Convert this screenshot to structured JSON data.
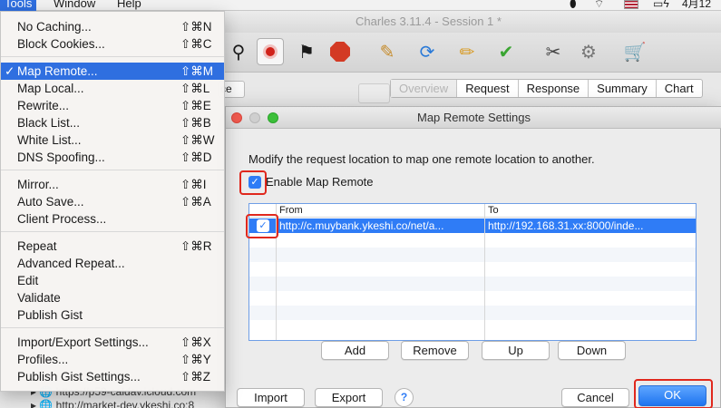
{
  "menubar": {
    "tools": "Tools",
    "window": "Window",
    "help": "Help",
    "flag_icon": "us-flag-icon",
    "clock": "4月12"
  },
  "charles": {
    "title": "Charles 3.11.4 - Session 1 *",
    "sequence_label": "ce",
    "tabs": [
      "Overview",
      "Request",
      "Response",
      "Summary",
      "Chart"
    ],
    "tree_rows": [
      "https://p59-caldav.icloud.com",
      "http://market-dev.ykeshi.co:8"
    ]
  },
  "dialog": {
    "title": "Map Remote Settings",
    "description": "Modify the request location to map one remote location to another.",
    "enable_label": "Enable Map Remote",
    "enable_checked": true,
    "columns": [
      "From",
      "To"
    ],
    "rows": [
      {
        "checked": true,
        "from": "http://c.muybank.ykeshi.co/net/a...",
        "to": "http://192.168.31.xx:8000/inde..."
      }
    ],
    "buttons": {
      "add": "Add",
      "remove": "Remove",
      "up": "Up",
      "down": "Down",
      "import": "Import",
      "export": "Export",
      "help": "?",
      "cancel": "Cancel",
      "ok": "OK"
    },
    "accent": "#2f7cf6",
    "highlight": "#e0281d"
  },
  "menu": {
    "groups": [
      [
        {
          "label": "No Caching...",
          "shortcut": "⇧⌘N"
        },
        {
          "label": "Block Cookies...",
          "shortcut": "⇧⌘C"
        }
      ],
      [
        {
          "label": "Map Remote...",
          "shortcut": "⇧⌘M",
          "checked": true,
          "selected": true
        },
        {
          "label": "Map Local...",
          "shortcut": "⇧⌘L"
        },
        {
          "label": "Rewrite...",
          "shortcut": "⇧⌘E"
        },
        {
          "label": "Black List...",
          "shortcut": "⇧⌘B"
        },
        {
          "label": "White List...",
          "shortcut": "⇧⌘W"
        },
        {
          "label": "DNS Spoofing...",
          "shortcut": "⇧⌘D"
        }
      ],
      [
        {
          "label": "Mirror...",
          "shortcut": "⇧⌘I"
        },
        {
          "label": "Auto Save...",
          "shortcut": "⇧⌘A"
        },
        {
          "label": "Client Process...",
          "shortcut": ""
        }
      ],
      [
        {
          "label": "Repeat",
          "shortcut": "⇧⌘R"
        },
        {
          "label": "Advanced Repeat...",
          "shortcut": ""
        },
        {
          "label": "Edit",
          "shortcut": ""
        },
        {
          "label": "Validate",
          "shortcut": ""
        },
        {
          "label": "Publish Gist",
          "shortcut": ""
        }
      ],
      [
        {
          "label": "Import/Export Settings...",
          "shortcut": "⇧⌘X"
        },
        {
          "label": "Profiles...",
          "shortcut": "⇧⌘Y"
        },
        {
          "label": "Publish Gist Settings...",
          "shortcut": "⇧⌘Z"
        }
      ]
    ],
    "check_glyph": "✓"
  }
}
